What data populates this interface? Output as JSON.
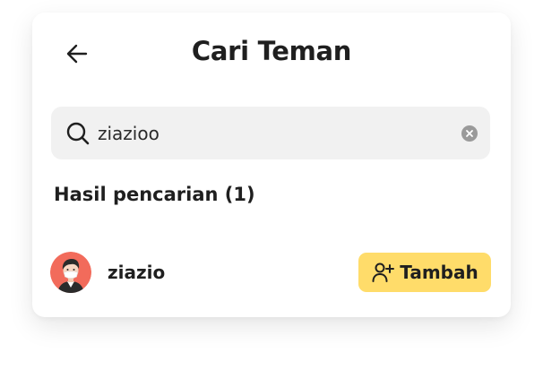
{
  "header": {
    "title": "Cari Teman",
    "back_icon": "arrow-left-icon"
  },
  "search": {
    "value": "ziazioo",
    "search_icon": "search-icon",
    "clear_icon": "clear-icon"
  },
  "results": {
    "heading": "Hasil pencarian (1)",
    "items": [
      {
        "username": "ziazio",
        "avatar_bg": "#f26b5b",
        "action_label": "Tambah",
        "action_icon": "add-user-icon"
      }
    ]
  },
  "colors": {
    "accent": "#ffdc6a",
    "search_bg": "#f1f1f1",
    "text": "#1f1f1f"
  }
}
